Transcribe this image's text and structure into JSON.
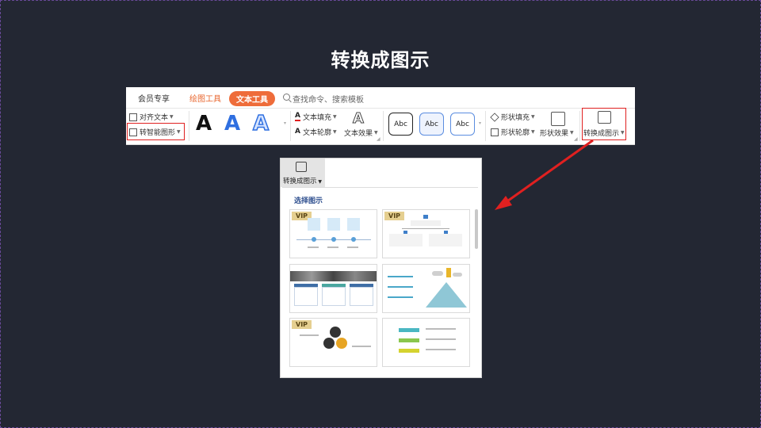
{
  "slide": {
    "title": "转换成图示"
  },
  "ribbon": {
    "tabs": {
      "member": "会员专享",
      "draw_tool": "绘图工具",
      "text_tool": "文本工具"
    },
    "search_placeholder": "查找命令、搜索模板",
    "align_text": "对齐文本",
    "smart_shape": "转智能图形",
    "text_fill": "文本填充",
    "text_outline": "文本轮廓",
    "text_effect": "文本效果",
    "big_letter": "A",
    "abc_label": "Abc",
    "shape_fill": "形状填充",
    "shape_outline": "形状轮廓",
    "shape_effect": "形状效果",
    "convert_diagram": "转换成图示",
    "accent_color": "#ee6c3a",
    "highlight_color": "#e02020"
  },
  "dropdown": {
    "button_label": "转换成图示",
    "heading": "选择图示",
    "vip_badge": "VIP",
    "templates": [
      {
        "id": "timeline-pins",
        "vip": true
      },
      {
        "id": "org-chart",
        "vip": true
      },
      {
        "id": "photo-columns",
        "vip": false
      },
      {
        "id": "mountain-flag",
        "vip": false
      },
      {
        "id": "triangle-cycle",
        "vip": true
      },
      {
        "id": "colored-steps",
        "vip": false
      }
    ]
  }
}
